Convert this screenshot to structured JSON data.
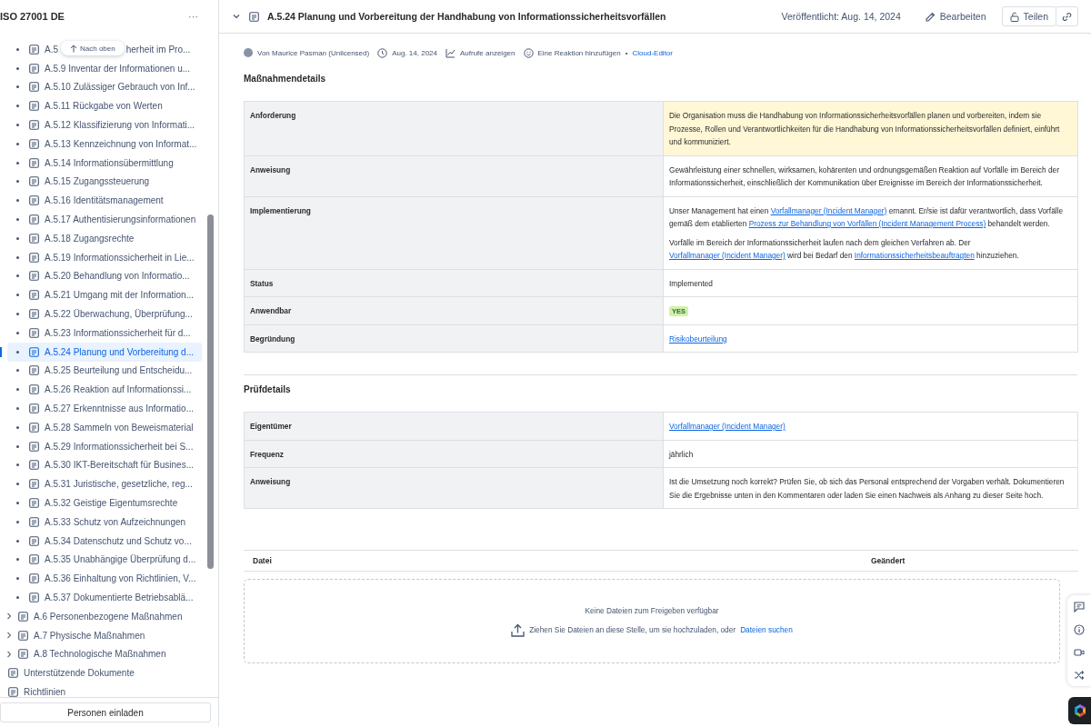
{
  "sidebar": {
    "title": "ISO 27001 DE",
    "more": "···",
    "back_to_top": "Nach oben",
    "items": [
      {
        "kind": "leaf",
        "label": "A.5",
        "label_tail": "herheit im Pro...",
        "selected": false
      },
      {
        "kind": "leaf",
        "label": "A.5.9 Inventar der Informationen u...",
        "selected": false
      },
      {
        "kind": "leaf",
        "label": "A.5.10 Zulässiger Gebrauch von Inf...",
        "selected": false
      },
      {
        "kind": "leaf",
        "label": "A.5.11 Rückgabe von Werten",
        "selected": false
      },
      {
        "kind": "leaf",
        "label": "A.5.12 Klassifizierung von Informati...",
        "selected": false
      },
      {
        "kind": "leaf",
        "label": "A.5.13 Kennzeichnung von Informat...",
        "selected": false
      },
      {
        "kind": "leaf",
        "label": "A.5.14 Informationsübermittlung",
        "selected": false
      },
      {
        "kind": "leaf",
        "label": "A.5.15 Zugangssteuerung",
        "selected": false
      },
      {
        "kind": "leaf",
        "label": "A.5.16 Identitätsmanagement",
        "selected": false
      },
      {
        "kind": "leaf",
        "label": "A.5.17 Authentisierungsinformationen",
        "selected": false
      },
      {
        "kind": "leaf",
        "label": "A.5.18 Zugangsrechte",
        "selected": false
      },
      {
        "kind": "leaf",
        "label": "A.5.19 Informationssicherheit in Lie...",
        "selected": false
      },
      {
        "kind": "leaf",
        "label": "A.5.20 Behandlung von Informatio...",
        "selected": false
      },
      {
        "kind": "leaf",
        "label": "A.5.21 Umgang mit der Information...",
        "selected": false
      },
      {
        "kind": "leaf",
        "label": "A.5.22 Überwachung, Überprüfung...",
        "selected": false
      },
      {
        "kind": "leaf",
        "label": "A.5.23 Informationssicherheit für d...",
        "selected": false
      },
      {
        "kind": "leaf",
        "label": "A.5.24 Planung und Vorbereitung d...",
        "selected": true
      },
      {
        "kind": "leaf",
        "label": "A.5.25 Beurteilung und Entscheidu...",
        "selected": false
      },
      {
        "kind": "leaf",
        "label": "A.5.26 Reaktion auf Informationssi...",
        "selected": false
      },
      {
        "kind": "leaf",
        "label": "A.5.27 Erkenntnisse aus Informatio...",
        "selected": false
      },
      {
        "kind": "leaf",
        "label": "A.5.28 Sammeln von Beweismaterial",
        "selected": false
      },
      {
        "kind": "leaf",
        "label": "A.5.29 Informationssicherheit bei S...",
        "selected": false
      },
      {
        "kind": "leaf",
        "label": "A.5.30 IKT-Bereitschaft für Busines...",
        "selected": false
      },
      {
        "kind": "leaf",
        "label": "A.5.31 Juristische, gesetzliche, reg...",
        "selected": false
      },
      {
        "kind": "leaf",
        "label": "A.5.32 Geistige Eigentumsrechte",
        "selected": false
      },
      {
        "kind": "leaf",
        "label": "A.5.33 Schutz von Aufzeichnungen",
        "selected": false
      },
      {
        "kind": "leaf",
        "label": "A.5.34 Datenschutz und Schutz vo...",
        "selected": false
      },
      {
        "kind": "leaf",
        "label": "A.5.35 Unabhängige Überprüfung d...",
        "selected": false
      },
      {
        "kind": "leaf",
        "label": "A.5.36 Einhaltung von Richtlinien, V...",
        "selected": false
      },
      {
        "kind": "leaf",
        "label": "A.5.37 Dokumentierte Betriebsablä...",
        "selected": false
      },
      {
        "kind": "group",
        "label": "A.6 Personenbezogene Maßnahmen",
        "selected": false,
        "expanded": false
      },
      {
        "kind": "group",
        "label": "A.7 Physische Maßnahmen",
        "selected": false,
        "expanded": false
      },
      {
        "kind": "group",
        "label": "A.8 Technologische Maßnahmen",
        "selected": false,
        "expanded": false
      },
      {
        "kind": "page",
        "label": "Unterstützende Dokumente",
        "selected": false
      },
      {
        "kind": "page",
        "label": "Richtlinien",
        "selected": false
      }
    ],
    "invite_button": "Personen einladen"
  },
  "header": {
    "title": "A.5.24 Planung und Vorbereitung der Handhabung von Informationssicherheitsvorfällen",
    "published": "Veröffentlicht: Aug. 14, 2024",
    "edit": "Bearbeiten",
    "share": "Teilen"
  },
  "byline": {
    "author": "Von Maurice Pasman (Unlicensed)",
    "date": "Aug. 14, 2024",
    "views": "Aufrufe anzeigen",
    "reaction": "Eine Reaktion hinzufügen",
    "separator": "•",
    "editor": "Cloud-Editor"
  },
  "sections": [
    {
      "title": "Maßnahmendetails",
      "rows": [
        {
          "label": "Anforderung",
          "highlight": true,
          "paragraphs": [
            [
              {
                "kind": "text",
                "text": "Die Organisation muss die Handhabung von Informationssicherheitsvorfällen planen und vorbereiten, indem sie Prozesse, Rollen und Verantwortlichkeiten für die Handhabung von Informationssicherheitsvorfällen definiert, einführt und kommuniziert."
              }
            ]
          ]
        },
        {
          "label": "Anweisung",
          "highlight": false,
          "paragraphs": [
            [
              {
                "kind": "text",
                "text": "Gewährleistung einer schnellen, wirksamen, kohärenten und ordnungsgemäßen Reaktion auf Vorfälle im Bereich der Informationssicherheit, einschließlich der Kommunikation über Ereignisse im Bereich der Informationssicherheit."
              }
            ]
          ]
        },
        {
          "label": "Implementierung",
          "highlight": false,
          "paragraphs": [
            [
              {
                "kind": "text",
                "text": "Unser Management hat einen "
              },
              {
                "kind": "link",
                "text": "Vorfallmanager (Incident Manager)"
              },
              {
                "kind": "text",
                "text": " ernannt. Er/sie ist dafür verantwortlich, dass Vorfälle gemäß dem etablierten "
              },
              {
                "kind": "link",
                "text": "Prozess zur Behandlung von Vorfällen (Incident Management Process)"
              },
              {
                "kind": "text",
                "text": " behandelt werden."
              }
            ],
            [
              {
                "kind": "text",
                "text": "Vorfälle im Bereich der Informationssicherheit laufen nach dem gleichen Verfahren ab. Der "
              },
              {
                "kind": "link",
                "text": "Vorfallmanager (Incident Manager)"
              },
              {
                "kind": "text",
                "text": " wird bei Bedarf den "
              },
              {
                "kind": "link",
                "text": "Informationssicherheitsbeauftragten"
              },
              {
                "kind": "text",
                "text": " hinzuziehen."
              }
            ]
          ]
        },
        {
          "label": "Status",
          "highlight": false,
          "paragraphs": [
            [
              {
                "kind": "text",
                "text": "Implemented"
              }
            ]
          ]
        },
        {
          "label": "Anwendbar",
          "highlight": false,
          "paragraphs": [
            [
              {
                "kind": "tag",
                "text": "YES",
                "color": "#d3f1a7"
              }
            ]
          ]
        },
        {
          "label": "Begründung",
          "highlight": false,
          "paragraphs": [
            [
              {
                "kind": "link",
                "text": "Risikobeurteilung"
              }
            ]
          ]
        }
      ]
    },
    {
      "title": "Prüfdetails",
      "rows": [
        {
          "label": "Eigentümer",
          "highlight": false,
          "paragraphs": [
            [
              {
                "kind": "link",
                "text": "Vorfallmanager (Incident Manager)"
              }
            ]
          ]
        },
        {
          "label": "Frequenz",
          "highlight": false,
          "paragraphs": [
            [
              {
                "kind": "text",
                "text": "jährlich"
              }
            ]
          ]
        },
        {
          "label": "Anweisung",
          "highlight": false,
          "paragraphs": [
            [
              {
                "kind": "text",
                "text": "Ist die Umsetzung noch korrekt? Prüfen Sie, ob sich das Personal entsprechend der Vorgaben verhält. Dokumentieren Sie die Ergebnisse unten in den Kommentaren oder laden Sie einen Nachweis als Anhang zu dieser Seite hoch."
              }
            ]
          ]
        }
      ]
    }
  ],
  "files": {
    "columns": [
      "Datei",
      "Geändert"
    ],
    "empty": "Keine Dateien zum Freigeben verfügbar",
    "drop_hint": "Ziehen Sie Dateien an diese Stelle, um sie hochzuladen, oder",
    "browse": "Dateien suchen"
  }
}
